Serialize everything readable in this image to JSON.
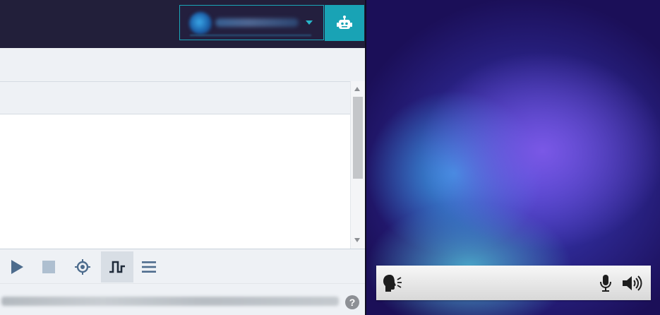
{
  "header": {
    "user_menu": {
      "avatar_icon": "user-avatar-icon",
      "name": "",
      "dropdown_icon": "caret-down-icon"
    },
    "assistant_button_icon": "robot-icon",
    "accent_color": "#19a3b5",
    "background_color": "#221f3a"
  },
  "toolbar": {
    "buttons": [
      {
        "icon": "play-icon",
        "active": false
      },
      {
        "icon": "stop-icon",
        "active": false
      },
      {
        "icon": "crosshair-icon",
        "active": false
      },
      {
        "icon": "square-wave-icon",
        "active": true
      },
      {
        "icon": "menu-icon",
        "active": false
      }
    ]
  },
  "statusbar": {
    "url": "",
    "help_label": "?"
  },
  "assistant": {
    "voice_bar": {
      "speak_icon": "speaking-head-icon",
      "mic_icon": "microphone-icon",
      "volume_icon": "volume-icon"
    }
  }
}
